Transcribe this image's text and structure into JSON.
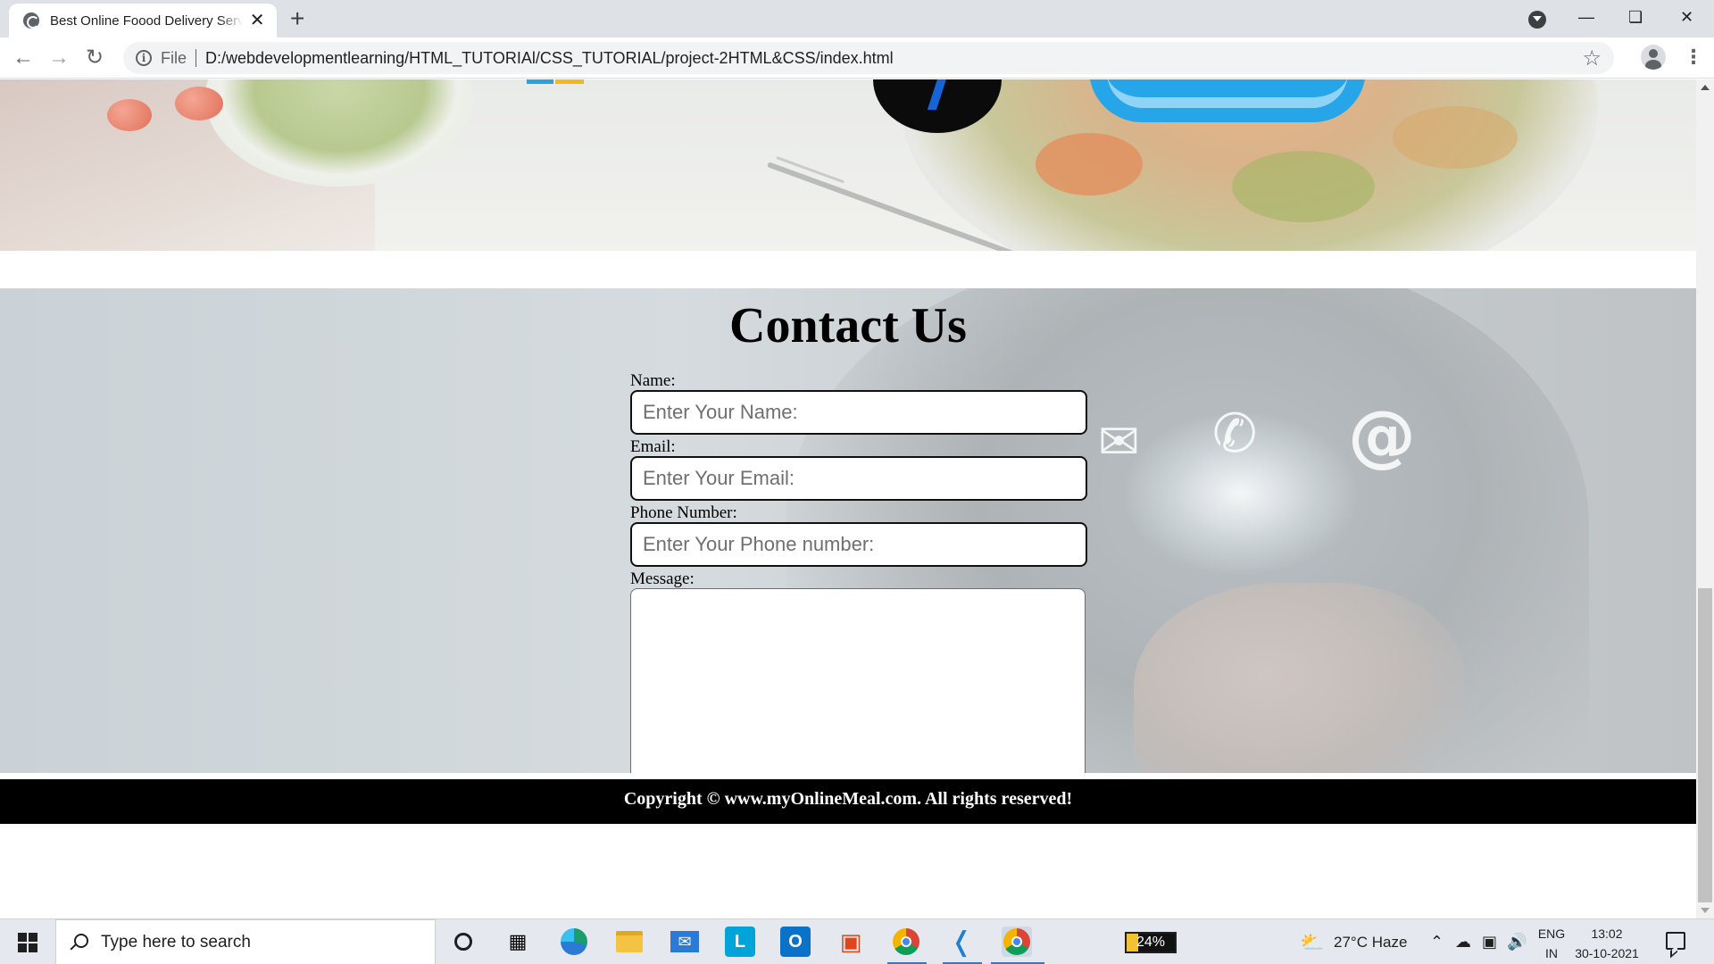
{
  "browser": {
    "tab_title": "Best Online Foood Delivery Servi",
    "tab_close": "✕",
    "new_tab": "+",
    "url_scheme_label": "File",
    "url": "D:/webdevelopmentlearning/HTML_TUTORIAl/CSS_TUTORIAL/project-2HTML&CSS/index.html",
    "icons": [
      "back-icon",
      "forward-icon",
      "reload-icon",
      "info-icon",
      "star-icon",
      "profile-icon",
      "menu-icon"
    ]
  },
  "page": {
    "contact": {
      "title": "Contact Us",
      "fields": {
        "name_label": "Name:",
        "name_placeholder": "Enter Your Name:",
        "email_label": "Email:",
        "email_placeholder": "Enter Your Email:",
        "phone_label": "Phone Number:",
        "phone_placeholder": "Enter Your Phone number:",
        "message_label": "Message:"
      }
    },
    "footer": {
      "copyright": "Copyright © www.myOnlineMeal.com. All rights reserved!"
    }
  },
  "taskbar": {
    "search_placeholder": "Type here to search",
    "battery": "24%",
    "weather": "27°C  Haze",
    "lang_top": "ENG",
    "lang_bottom": "IN",
    "time": "13:02",
    "date": "30-10-2021",
    "apps": [
      "cortana-icon",
      "task-view-icon",
      "edge-icon",
      "file-explorer-icon",
      "mail-icon",
      "l-app-icon",
      "outlook-icon",
      "office-icon",
      "chrome-icon",
      "vscode-icon",
      "chrome-icon"
    ]
  },
  "colors": {
    "footer_bg": "#000000",
    "footer_text": "#ffffff",
    "taskbar_accent": "#2b7ad6"
  }
}
